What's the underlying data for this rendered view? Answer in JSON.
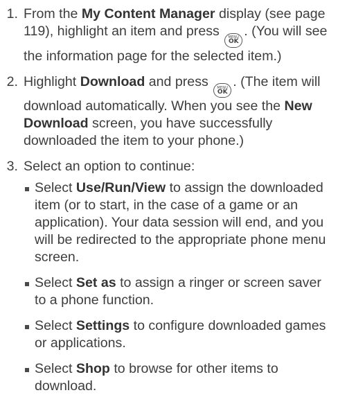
{
  "steps": [
    {
      "number": "1.",
      "before": "From the ",
      "bold1": "My Content Manager",
      "middle": " display (see page 119), highlight an item and press ",
      "after": ". (You will see the information page for the selected item.)"
    },
    {
      "number": "2.",
      "before": "Highlight ",
      "bold1": "Download",
      "middle": " and press ",
      "after1": ". (The item will download automatically. When you see the ",
      "bold2": "New Download",
      "after2": " screen, you have successfully downloaded the item to your phone.)"
    },
    {
      "number": "3.",
      "text": "Select an option to continue:",
      "options": [
        {
          "prefix": "Select ",
          "bold": "Use/Run/View",
          "rest": " to assign the downloaded item (or to start, in the case of a game or an application). Your data session will end, and you will be redirected to the appropriate phone menu screen."
        },
        {
          "prefix": "Select ",
          "bold": "Set as",
          "rest": " to assign a ringer or screen saver to a phone function."
        },
        {
          "prefix": "Select ",
          "bold": "Settings",
          "rest": " to configure downloaded games or applications."
        },
        {
          "prefix": "Select ",
          "bold": "Shop",
          "rest": " to browse for other items to download."
        }
      ]
    }
  ],
  "key_icon": {
    "name": "menu-ok-key-icon",
    "top_label": "MENU",
    "bottom_label": "OK"
  }
}
